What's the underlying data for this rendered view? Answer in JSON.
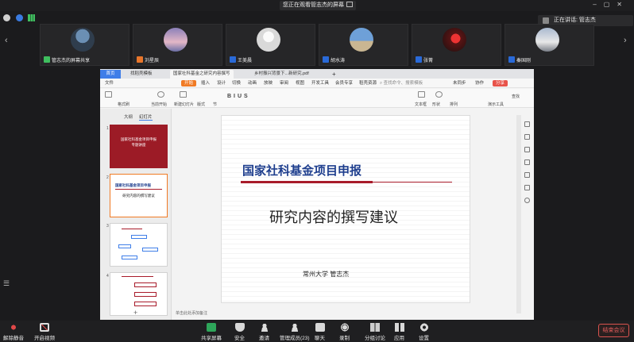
{
  "top_bar": {
    "viewing_text": "您正在观看管志杰的屏幕"
  },
  "speaking": {
    "label": "正在讲话: 管志杰"
  },
  "gallery": {
    "tiles": [
      {
        "name": "管志杰的屏幕共享"
      },
      {
        "name": "刘星辰"
      },
      {
        "name": "王美晨"
      },
      {
        "name": "胡水涛"
      },
      {
        "name": "张菁"
      },
      {
        "name": "秦国刚"
      }
    ]
  },
  "wps": {
    "home_tab": "首页",
    "tabs": [
      "找稻壳模板",
      "国家社科基金之研究内容撰写",
      "乡村振兴背景下...新研究.pdf"
    ],
    "menu": [
      "文件",
      "开始",
      "插入",
      "设计",
      "切换",
      "动画",
      "放映",
      "审阅",
      "视图",
      "开发工具",
      "会员专享",
      "稻壳资源"
    ],
    "search_placeholder": "查找命令、搜索模板",
    "right_menu": [
      "未同步",
      "协作",
      "分享"
    ],
    "ribbon_labels": [
      "格式刷",
      "当前开始",
      "新建幻灯片",
      "版式",
      "节",
      "文本框",
      "形状",
      "排列",
      "演示工具",
      "查找"
    ],
    "pane_tabs": [
      "大纲",
      "幻灯片"
    ],
    "thumb_numbers": [
      "1",
      "2",
      "3",
      "4"
    ],
    "thumb_texts": {
      "t1_title": "国家社科基金项目申报",
      "t1_sub": "专题讲座",
      "t2_title": "国家社科基金项目申报",
      "t2_sub": "研究内容的撰写建议"
    },
    "slide": {
      "title": "国家社科基金项目申报",
      "subtitle": "研究内容的撰写建议",
      "author": "常州大学    管志杰"
    },
    "notes_placeholder": "单击此处添加备注"
  },
  "bottom_bar": {
    "buttons": [
      {
        "label": "解除静音"
      },
      {
        "label": "开启视频"
      },
      {
        "label": "共享屏幕"
      },
      {
        "label": "安全"
      },
      {
        "label": "邀请"
      },
      {
        "label": "管理成员(23)"
      },
      {
        "label": "聊天"
      },
      {
        "label": "录制"
      },
      {
        "label": "分组讨论"
      },
      {
        "label": "应用"
      },
      {
        "label": "设置"
      }
    ],
    "end_meeting": "结束会议"
  },
  "colors": {
    "accent_blue": "#3f7ee8",
    "wps_orange": "#f07a24",
    "slide_title_blue": "#1f3f8e",
    "slide_red": "#a81b2a",
    "end_red": "#e05c5c"
  }
}
